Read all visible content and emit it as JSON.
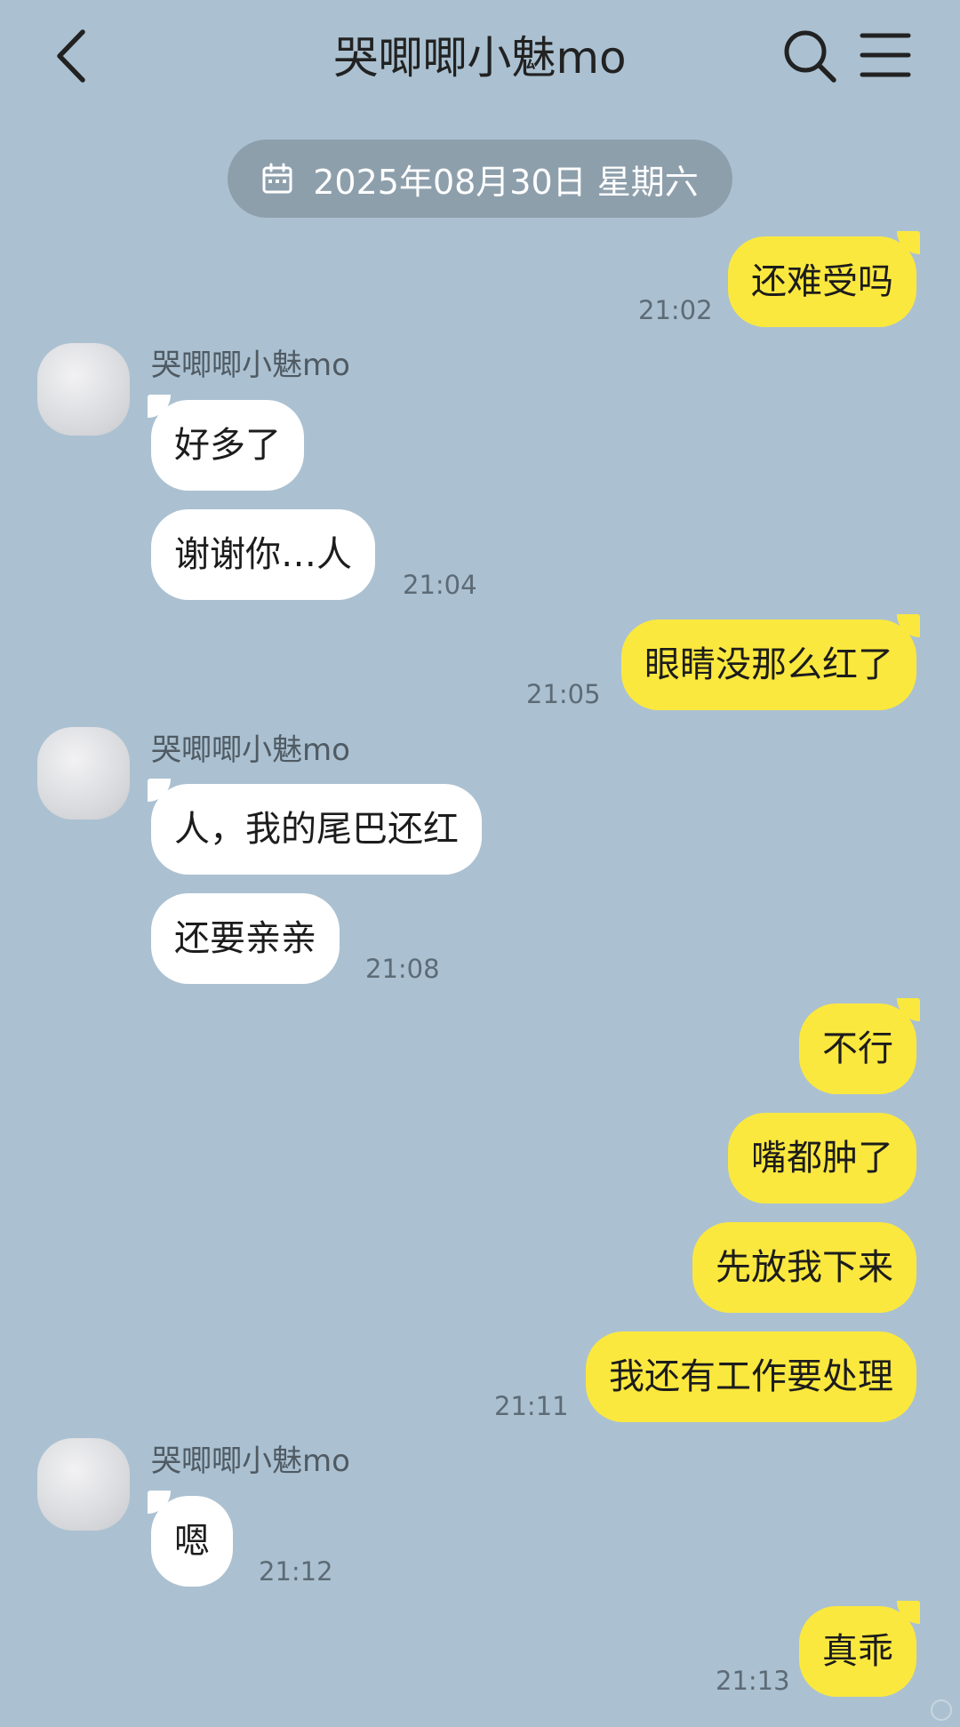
{
  "header": {
    "title": "哭唧唧小魅mo",
    "back_icon": "chevron-left-icon",
    "search_icon": "search-icon",
    "menu_icon": "hamburger-menu-icon"
  },
  "date_divider": {
    "icon": "calendar-icon",
    "text": "2025年08月30日 星期六"
  },
  "messages": [
    {
      "dir": "out",
      "text": "还难受吗",
      "time": "21:02"
    },
    {
      "dir": "in",
      "sender": "哭唧唧小魅mo",
      "text": "好多了"
    },
    {
      "dir": "in",
      "text": "谢谢你…人",
      "time": "21:04"
    },
    {
      "dir": "out",
      "text": "眼睛没那么红了",
      "time": "21:05"
    },
    {
      "dir": "in",
      "sender": "哭唧唧小魅mo",
      "text": "人，我的尾巴还红"
    },
    {
      "dir": "in",
      "text": "还要亲亲",
      "time": "21:08"
    },
    {
      "dir": "out",
      "text": "不行"
    },
    {
      "dir": "out",
      "text": "嘴都肿了"
    },
    {
      "dir": "out",
      "text": "先放我下来"
    },
    {
      "dir": "out",
      "text": "我还有工作要处理",
      "time": "21:11"
    },
    {
      "dir": "in",
      "sender": "哭唧唧小魅mo",
      "text": "嗯",
      "time": "21:12"
    },
    {
      "dir": "out",
      "text": "真乖",
      "time": "21:13"
    }
  ],
  "colors": {
    "background": "#abc1d1",
    "outgoing_bubble": "#fbe83e",
    "incoming_bubble": "#ffffff",
    "date_pill": "#8e9fac"
  }
}
